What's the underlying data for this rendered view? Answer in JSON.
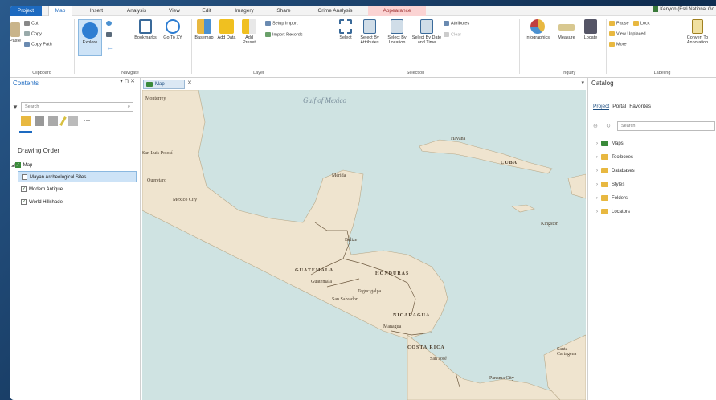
{
  "tabs": [
    "Project",
    "Map",
    "Insert",
    "Analysis",
    "View",
    "Edit",
    "Imagery",
    "Share",
    "Crime Analysis",
    "Appearance"
  ],
  "user": "Kenyon (Esri National Go",
  "ribbon": {
    "clipboard": {
      "paste": "Paste",
      "cut": "Cut",
      "copy": "Copy",
      "copy_path": "Copy Path",
      "group": "Clipboard"
    },
    "navigate": {
      "explore": "Explore",
      "bookmarks": "Bookmarks",
      "goto": "Go To XY",
      "group": "Navigate"
    },
    "layer": {
      "basemap": "Basemap",
      "add_data": "Add Data",
      "add_preset": "Add Preset",
      "setup_import": "Setup Import",
      "import_records": "Import Records",
      "group": "Layer"
    },
    "selection": {
      "select": "Select",
      "by_attr": "Select By Attributes",
      "by_loc": "Select By Location",
      "by_date": "Select By Date and Time",
      "attributes": "Attributes",
      "clear": "Clear",
      "group": "Selection"
    },
    "inquiry": {
      "infographics": "Infographics",
      "measure": "Measure",
      "locate": "Locate",
      "group": "Inquiry"
    },
    "labeling": {
      "pause": "Pause",
      "lock": "Lock",
      "view_unplaced": "View Unplaced",
      "more": "More",
      "convert": "Convert To Annotation",
      "group": "Labeling"
    }
  },
  "contents": {
    "title": "Contents",
    "search_placeholder": "Search",
    "drawing_order": "Drawing Order",
    "map_node": "Map",
    "layers": [
      {
        "name": "Mayan Archeological Sites",
        "checked": false,
        "selected": true
      },
      {
        "name": "Modern Antique",
        "checked": true,
        "selected": false
      },
      {
        "name": "World Hillshade",
        "checked": true,
        "selected": false
      }
    ]
  },
  "map_view": {
    "tab_label": "Map",
    "labels": {
      "gulf": "Gulf of Mexico",
      "monterrey": "Monterrey",
      "sanluis": "San Luis Potosí",
      "queretaro": "Querétaro",
      "mexicocity": "Mexico City",
      "merida": "Mérida",
      "havana": "Havana",
      "cuba": "CUBA",
      "kingston": "Kingston",
      "belize": "Belize",
      "guatemala_c": "GUATEMALA",
      "guatemala": "Guatemala",
      "honduras": "HONDURAS",
      "tegucigalpa": "Tegucigalpa",
      "sansalvador": "San Salvador",
      "nicaragua": "NICARAGUA",
      "managua": "Managua",
      "costarica": "COSTA RICA",
      "sanjose": "San José",
      "panama": "Panama City",
      "cartagena": "Santa Cartagena"
    }
  },
  "catalog": {
    "title": "Catalog",
    "tabs": [
      "Project",
      "Portal",
      "Favorites"
    ],
    "search_placeholder": "Search",
    "items": [
      "Maps",
      "Toolboxes",
      "Databases",
      "Styles",
      "Folders",
      "Locators"
    ]
  },
  "colors": {
    "accent": "#1d6ac0",
    "water": "#cfe3e2",
    "land": "#efe4cf",
    "selected": "#cde3f7"
  }
}
